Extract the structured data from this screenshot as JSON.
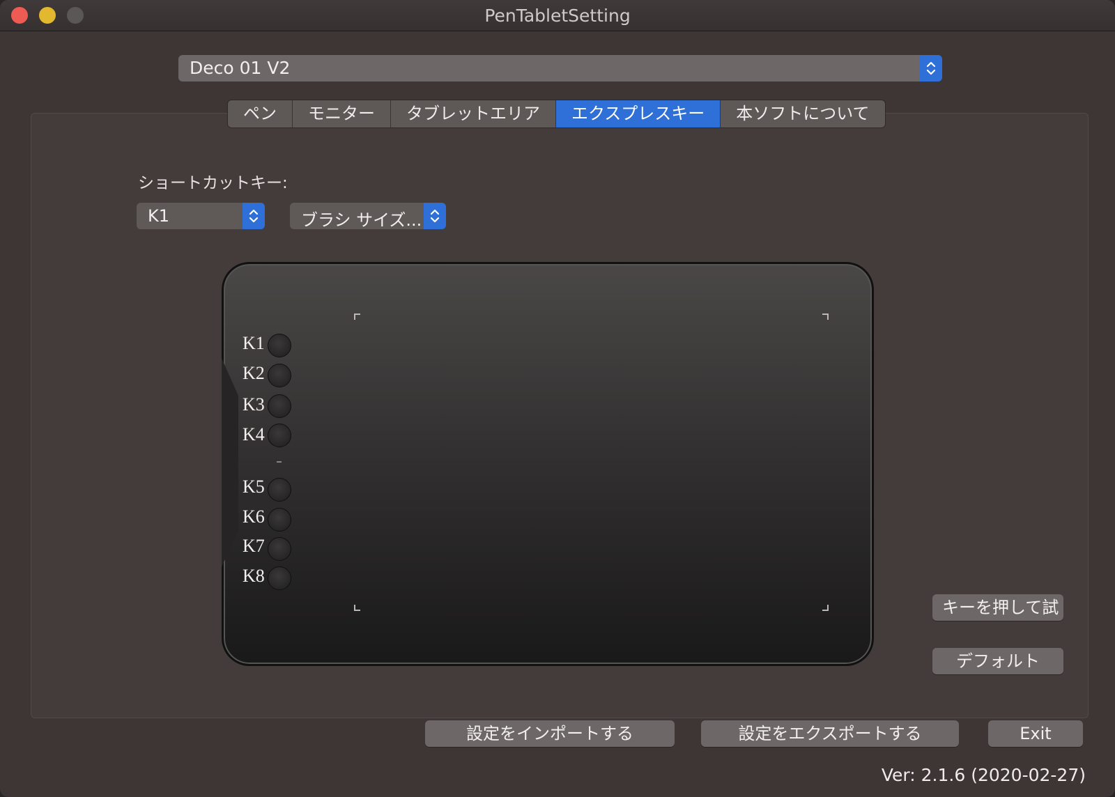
{
  "window": {
    "title": "PenTabletSetting"
  },
  "device": {
    "selected": "Deco 01 V2"
  },
  "tabs": [
    {
      "label": "ペン"
    },
    {
      "label": "モニター"
    },
    {
      "label": "タブレットエリア"
    },
    {
      "label": "エクスプレスキー",
      "active": true
    },
    {
      "label": "本ソフトについて"
    }
  ],
  "shortcut": {
    "label": "ショートカットキー:",
    "key_selected": "K1",
    "function_selected": "ブラシ サイズ..."
  },
  "tablet": {
    "keys": [
      "K1",
      "K2",
      "K3",
      "K4",
      "K5",
      "K6",
      "K7",
      "K8"
    ]
  },
  "buttons": {
    "test": "キーを押して試",
    "default": "デフォルト",
    "import": "設定をインポートする",
    "export": "設定をエクスポートする",
    "exit": "Exit"
  },
  "version": "Ver: 2.1.6 (2020-02-27)",
  "colors": {
    "accent": "#2e6fd8",
    "window_bg": "#3d3635"
  }
}
